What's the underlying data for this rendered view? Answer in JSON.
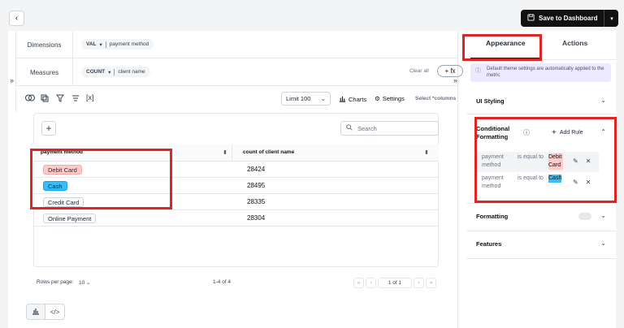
{
  "header": {
    "save_label": "Save to Dashboard"
  },
  "fields": {
    "dimensions_label": "Dimensions",
    "dimension_agg": "VAL",
    "dimension_field": "payment method",
    "measures_label": "Measures",
    "measure_agg": "COUNT",
    "measure_field": "client name",
    "clear_all": "Clear all",
    "fx_label": "+ fx"
  },
  "toolbar": {
    "limit": "Limit 100",
    "charts": "Charts",
    "settings": "Settings",
    "select_columns": "Select *columns"
  },
  "search": {
    "placeholder": "Search"
  },
  "table": {
    "columns": [
      "payment method",
      "count of client name"
    ],
    "rows": [
      {
        "method": "Debit Card",
        "count": "28424",
        "tag_bg": "#fecaca"
      },
      {
        "method": "Cash",
        "count": "28495",
        "tag_bg": "#38bdf8"
      },
      {
        "method": "Credit Card",
        "count": "28335",
        "tag_bg": "#f9fafb"
      },
      {
        "method": "Online Payment",
        "count": "28304",
        "tag_bg": "#f9fafb"
      }
    ]
  },
  "footer": {
    "rows_per_page_label": "Rows per page:",
    "rows_per_page_value": "10",
    "range": "1-4 of 4",
    "page": "1 of 1"
  },
  "panel": {
    "tab_appearance": "Appearance",
    "tab_actions": "Actions",
    "info_text": "Default theme settings are automatically applied to the metric",
    "ui_styling": "UI Styling",
    "conditional_formatting": "Conditional Formatting",
    "add_rule": "Add Rule",
    "rules": [
      {
        "field": "payment method",
        "op": "is equal to",
        "value": "Debit Card",
        "highlight": "#fecaca"
      },
      {
        "field": "payment method",
        "op": "is equal to",
        "value": "Cash",
        "highlight": "#38bdf8"
      }
    ],
    "formatting": "Formatting",
    "features": "Features"
  },
  "colors": {
    "highlight_red": "#dc2626",
    "accent": "#111111"
  }
}
